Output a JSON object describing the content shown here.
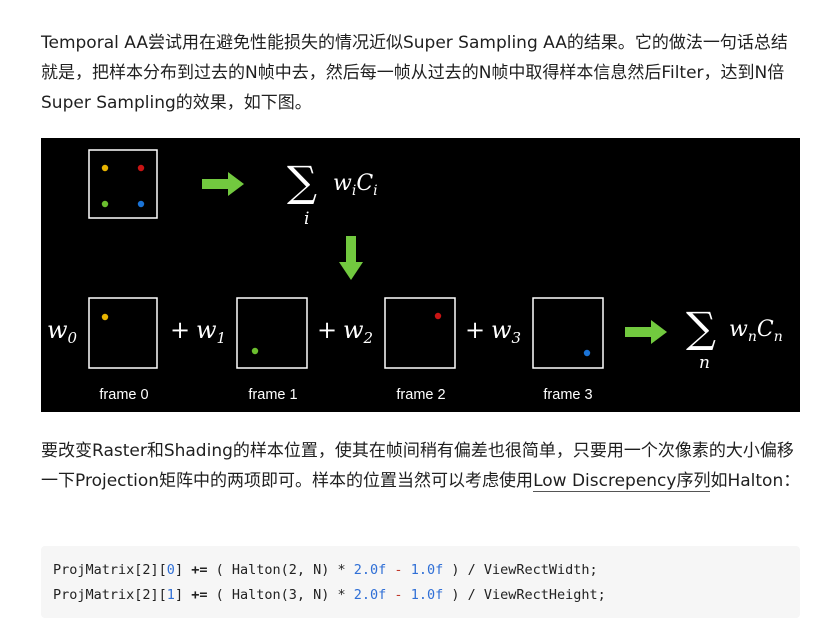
{
  "paragraph1": "Temporal AA尝试用在避免性能损失的情况近似Super Sampling AA的结果。它的做法一句话总结就是，把样本分布到过去的N帧中去，然后每一帧从过去的N帧中取得样本信息然后Filter，达到N倍Super Sampling的效果，如下图。",
  "figure": {
    "frame_labels": [
      "frame 0",
      "frame 1",
      "frame 2",
      "frame 3"
    ],
    "sum_top": {
      "sigma": "∑",
      "index": "i",
      "expr": "wiCi",
      "w": "w",
      "w_sub": "i",
      "c": "C",
      "c_sub": "i"
    },
    "weights": [
      {
        "w": "w",
        "sub": "0"
      },
      {
        "op": "+",
        "w": "w",
        "sub": "1"
      },
      {
        "op": "+",
        "w": "w",
        "sub": "2"
      },
      {
        "op": "+",
        "w": "w",
        "sub": "3"
      }
    ],
    "sum_bottom": {
      "sigma": "∑",
      "index": "n",
      "w": "w",
      "w_sub": "n",
      "c": "C",
      "c_sub": "n"
    },
    "colors": {
      "yellow": "#e8b400",
      "red": "#c81414",
      "green": "#6bbe2e",
      "blue": "#1a73d6",
      "arrow": "#72c93f"
    }
  },
  "paragraph2": {
    "before_link": "要改变Raster和Shading的样本位置，使其在帧间稍有偏差也很简单，只要用一个次像素的大小偏移一下Projection矩阵中的两项即可。样本的位置当然可以考虑使用",
    "link": "Low Discrepency序列",
    "after_link": "如Halton："
  },
  "code": [
    {
      "a": "ProjMatrix[2][",
      "idx": "0",
      "b": "] ",
      "op": "+=",
      "c": " ( Halton(2, N) * ",
      "n1": "2.0f",
      "m": " - ",
      "n2": "1.0f",
      "d": " ) / ViewRectWidth;"
    },
    {
      "a": "ProjMatrix[2][",
      "idx": "1",
      "b": "] ",
      "op": "+=",
      "c": " ( Halton(3, N) * ",
      "n1": "2.0f",
      "m": " - ",
      "n2": "1.0f",
      "d": " ) / ViewRectHeight;"
    }
  ]
}
